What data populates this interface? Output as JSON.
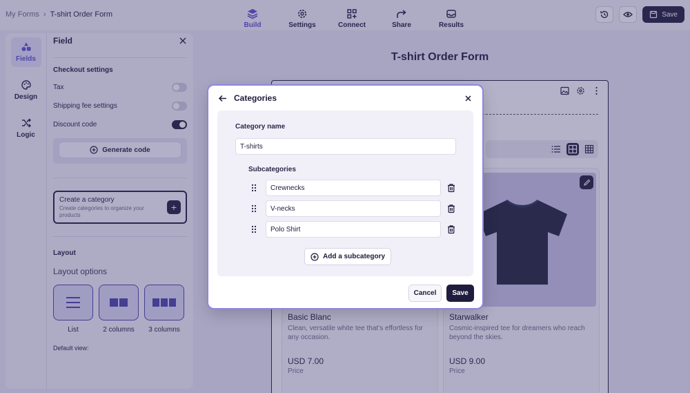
{
  "breadcrumb": {
    "root": "My Forms",
    "separator": "›",
    "current": "T-shirt Order Form"
  },
  "nav_tabs": [
    {
      "label": "Build",
      "icon": "layers-icon",
      "active": true
    },
    {
      "label": "Settings",
      "icon": "gear-icon"
    },
    {
      "label": "Connect",
      "icon": "connect-icon"
    },
    {
      "label": "Share",
      "icon": "share-icon"
    },
    {
      "label": "Results",
      "icon": "inbox-icon"
    }
  ],
  "top_actions": {
    "save_label": "Save"
  },
  "rail": [
    {
      "label": "Fields",
      "icon": "shapes-icon",
      "active": true
    },
    {
      "label": "Design",
      "icon": "palette-icon"
    },
    {
      "label": "Logic",
      "icon": "shuffle-icon"
    }
  ],
  "panel": {
    "title": "Field",
    "checkout_title": "Checkout settings",
    "toggles": [
      {
        "label": "Tax",
        "on": false
      },
      {
        "label": "Shipping fee settings",
        "on": false
      },
      {
        "label": "Discount code",
        "on": true
      }
    ],
    "generate_code": "Generate code",
    "create_category": {
      "title": "Create a category",
      "subtitle": "Create categories to organize your products"
    },
    "layout_title": "Layout",
    "layout_options_title": "Layout options",
    "layout_options": [
      "List",
      "2 columns",
      "3 columns"
    ],
    "default_view": "Default view:"
  },
  "form": {
    "title": "T-shirt Order Form",
    "products": [
      {
        "name": "Basic Blanc",
        "description": "Clean, versatile white tee that’s effortless for any occasion.",
        "price": "USD 7.00",
        "price_label": "Price"
      },
      {
        "name": "Starwalker",
        "description": "Cosmic-inspired tee for dreamers who reach beyond the skies.",
        "price": "USD 9.00",
        "price_label": "Price"
      }
    ]
  },
  "modal": {
    "title": "Categories",
    "category_name_label": "Category name",
    "category_name_value": "T-shirts",
    "subcategories_label": "Subcategories",
    "subcategories": [
      "Crewnecks",
      "V-necks",
      "Polo Shirt"
    ],
    "add_subcategory": "Add a subcategory",
    "cancel": "Cancel",
    "save": "Save"
  }
}
